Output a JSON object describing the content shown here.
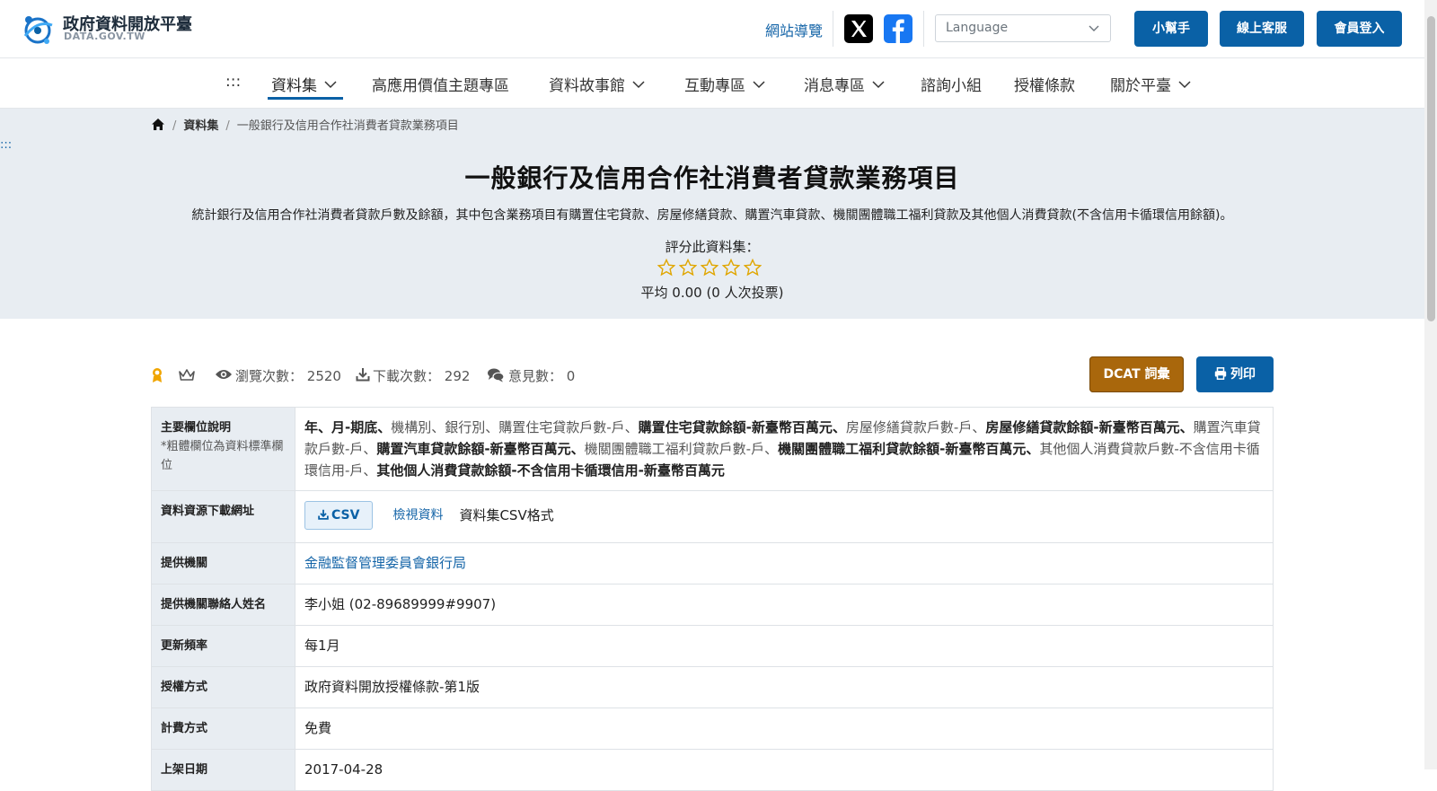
{
  "header": {
    "logo_title": "政府資料開放平臺",
    "logo_sub": "DATA.GOV.TW",
    "sitemap": "網站導覽",
    "language_placeholder": "Language",
    "buttons": {
      "helper": "小幫手",
      "support": "線上客服",
      "login": "會員登入"
    },
    "colors": {
      "primary": "#0a61a6",
      "link": "#1565a8"
    }
  },
  "nav": {
    "dots": ":::",
    "items": [
      {
        "label": "資料集",
        "dropdown": true,
        "active": true
      },
      {
        "label": "高應用價值主題專區",
        "dropdown": false
      },
      {
        "label": "資料故事館",
        "dropdown": true
      },
      {
        "label": "互動專區",
        "dropdown": true
      },
      {
        "label": "消息專區",
        "dropdown": true
      },
      {
        "label": "諮詢小組",
        "dropdown": false
      },
      {
        "label": "授權條款",
        "dropdown": false
      },
      {
        "label": "關於平臺",
        "dropdown": true
      }
    ]
  },
  "breadcrumb": {
    "dataset": "資料集",
    "current": "一般銀行及信用合作社消費者貸款業務項目"
  },
  "side_dots": ":::",
  "hero": {
    "title": "一般銀行及信用合作社消費者貸款業務項目",
    "description": "統計銀行及信用合作社消費者貸款戶數及餘額，其中包含業務項目有購置住宅貸款、房屋修繕貸款、購置汽車貸款、機關團體職工福利貸款及其他個人消費貸款(不含信用卡循環信用餘額)。",
    "rate_label": "評分此資料集：",
    "rating_value": 0,
    "rating_max": 5,
    "rating_avg": "平均 0.00 (0 人次投票)"
  },
  "stats": {
    "views_label": "瀏覽次數：",
    "views": "2520",
    "downloads_label": "下載次數：",
    "downloads": "292",
    "comments_label": "意見數：",
    "comments": "0"
  },
  "actions": {
    "dcat": "DCAT 詞彙",
    "print": "列印"
  },
  "table": {
    "fields_key": "主要欄位說明",
    "fields_note": "*粗體欄位為資料標準欄位",
    "fields": [
      {
        "text": "年、月-期底",
        "bold": true
      },
      {
        "text": "、",
        "bold": true
      },
      {
        "text": "機構別、銀行別、購置住宅貸款戶數-戶、",
        "bold": false
      },
      {
        "text": "購置住宅貸款餘額-新臺幣百萬元",
        "bold": true
      },
      {
        "text": "、",
        "bold": true
      },
      {
        "text": "房屋修繕貸款戶數-戶、",
        "bold": false
      },
      {
        "text": "房屋修繕貸款餘額-新臺幣百萬元",
        "bold": true
      },
      {
        "text": "、",
        "bold": true
      },
      {
        "text": "購置汽車貸款戶數-戶、",
        "bold": false
      },
      {
        "text": "購置汽車貸款餘額-新臺幣百萬元",
        "bold": true
      },
      {
        "text": "、",
        "bold": true
      },
      {
        "text": "機關團體職工福利貸款戶數-戶、",
        "bold": false
      },
      {
        "text": "機關團體職工福利貸款餘額-新臺幣百萬元",
        "bold": true
      },
      {
        "text": "、",
        "bold": true
      },
      {
        "text": "其他個人消費貸款戶數-不含信用卡循環信用-戶、",
        "bold": false
      },
      {
        "text": "其他個人消費貸款餘額-不含信用卡循環信用-新臺幣百萬元",
        "bold": true
      }
    ],
    "download_key": "資料資源下載網址",
    "csv_label": "CSV",
    "view_label": "檢視資料",
    "format_text": "資料集CSV格式",
    "provider_key": "提供機關",
    "provider": "金融監督管理委員會銀行局",
    "contact_key": "提供機關聯絡人姓名",
    "contact": "李小姐 (02-89689999#9907)",
    "freq_key": "更新頻率",
    "freq": "每1月",
    "license_key": "授權方式",
    "license": "政府資料開放授權條款-第1版",
    "fee_key": "計費方式",
    "fee": "免費",
    "date_key": "上架日期",
    "date": "2017-04-28"
  }
}
